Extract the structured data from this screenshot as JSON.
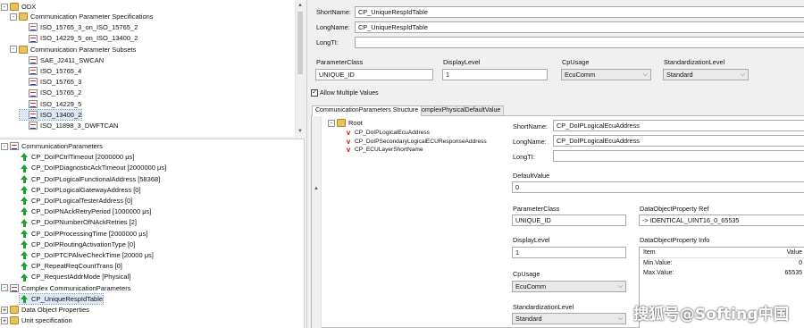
{
  "odx_tree": {
    "root": "ODX",
    "items": [
      {
        "label": "Communication Parameter Specifications",
        "depth": 1,
        "icon": "folder-icon",
        "expander": "-"
      },
      {
        "label": "ISO_15765_3_on_ISO_15765_2",
        "depth": 2,
        "icon": "protocol-icon"
      },
      {
        "label": "ISO_14229_5_on_ISO_13400_2",
        "depth": 2,
        "icon": "protocol-icon"
      },
      {
        "label": "Communication Parameter Subsets",
        "depth": 1,
        "icon": "folder-icon",
        "expander": "-"
      },
      {
        "label": "SAE_J2411_SWCAN",
        "depth": 2,
        "icon": "protocol-icon"
      },
      {
        "label": "ISO_15765_4",
        "depth": 2,
        "icon": "protocol-icon"
      },
      {
        "label": "ISO_15765_3",
        "depth": 2,
        "icon": "protocol-icon"
      },
      {
        "label": "ISO_15765_2",
        "depth": 2,
        "icon": "protocol-icon"
      },
      {
        "label": "ISO_14229_5",
        "depth": 2,
        "icon": "protocol-icon"
      },
      {
        "label": "ISO_13400_2",
        "depth": 2,
        "icon": "protocol-icon",
        "selected": true
      },
      {
        "label": "ISO_11898_3_DWFTCAN",
        "depth": 2,
        "icon": "protocol-icon"
      }
    ]
  },
  "param_tree": {
    "section": "CommunicationParameters",
    "items": [
      "CP_DoIPCtrlTimeout [2000000 μs]",
      "CP_DoIPDiagnosticAckTimeout [2000000 μs]",
      "CP_DoIPLogicalFunctionalAddress [58368]",
      "CP_DoIPLogicalGatewayAddress [0]",
      "CP_DoIPLogicalTesterAddress [0]",
      "CP_DoIPNAckRetryPeriod [1000000 μs]",
      "CP_DoIPNumberOfNAckRetries [2]",
      "CP_DoIPProcessingTime [2000000 μs]",
      "CP_DoIPRoutingActivationType [0]",
      "CP_DoIPTCPAliveCheckTime [20000 μs]",
      "CP_RepeatReqCountTrans [0]",
      "CP_RequestAddrMode [Physical]"
    ],
    "complex_section": "Complex CommunicationParameters",
    "complex_items": [
      "CP_UniqueRespIdTable"
    ],
    "bottom_sections": [
      "Data Object Properties",
      "Unit specification"
    ]
  },
  "detail": {
    "short_name_label": "ShortName:",
    "short_name": "CP_UniqueRespIdTable",
    "long_name_label": "LongName:",
    "long_name": "CP_UniqueRespIdTable",
    "long_ti_label": "LongTI:",
    "long_ti": "",
    "param_class_label": "ParameterClass",
    "param_class": "UNIQUE_ID",
    "display_level_label": "DisplayLevel",
    "display_level": "1",
    "cp_usage_label": "CpUsage",
    "cp_usage": "EcuComm",
    "std_level_label": "StandardizationLevel",
    "std_level": "Standard",
    "allow_multiple_label": "Allow Multiple Values",
    "allow_multiple": true
  },
  "tabs": [
    "CommunicationParameters Structure",
    "ComplexPhysicalDefaultValue"
  ],
  "struct_tree": {
    "root": "Root",
    "items": [
      "CP_DoIPLogicalEcuAddress",
      "CP_DoIPSecondaryLogicalECUResponseAddress",
      "CP_ECULayerShortName"
    ]
  },
  "sub_detail": {
    "short_name_label": "ShortName:",
    "short_name": "CP_DoIPLogicalEcuAddress",
    "long_name_label": "LongName:",
    "long_name": "CP_DoIPLogicalEcuAddress",
    "long_ti_label": "LongTI:",
    "long_ti": "",
    "default_value_label": "DefaultValue",
    "default_value": "0",
    "param_class_label": "ParameterClass",
    "param_class": "UNIQUE_ID",
    "dop_ref_label": "DataObjectProperty Ref",
    "dop_ref": "->  IDENTICAL_UINT16_0_65535",
    "display_level_label": "DisplayLevel",
    "display_level": "1",
    "dop_info_label": "DataObjectProperty Info",
    "dop_info_headers": [
      "Item",
      "Value"
    ],
    "dop_info_rows": [
      [
        "Min.Value:",
        "0"
      ],
      [
        "Max.Value:",
        "65535"
      ]
    ],
    "cp_usage_label": "CpUsage",
    "cp_usage": "EcuComm",
    "std_level_label": "StandardizationLevel",
    "std_level": "Standard"
  },
  "watermark": "搜狐号@Softing中国"
}
